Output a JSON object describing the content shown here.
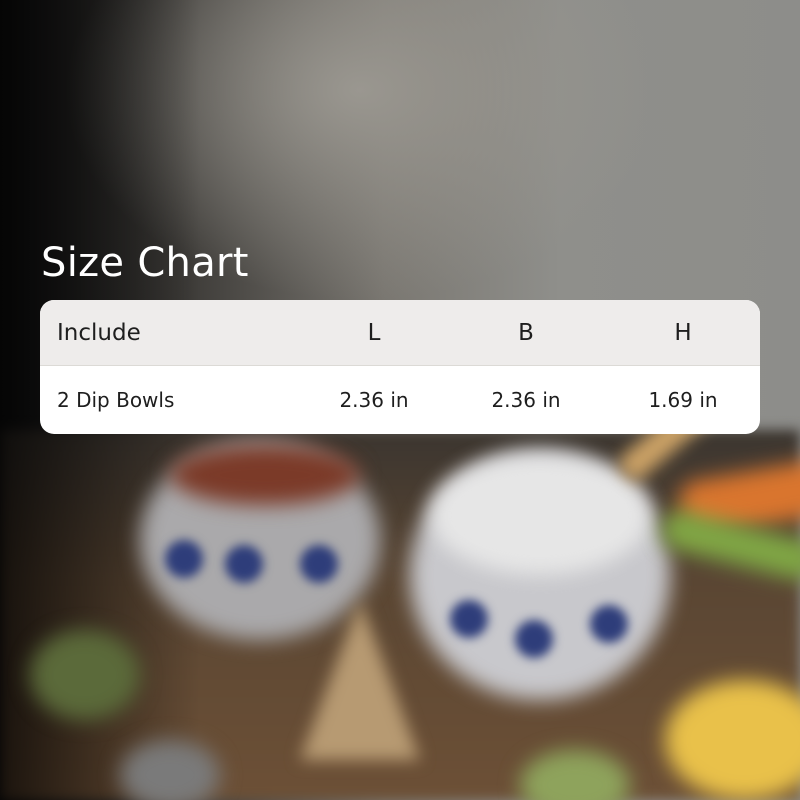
{
  "title": "Size Chart",
  "table": {
    "headers": [
      "Include",
      "L",
      "B",
      "H"
    ],
    "rows": [
      [
        "2 Dip Bowls",
        "2.36 in",
        "2.36 in",
        "1.69 in"
      ]
    ]
  },
  "colors": {
    "title_text": "#ffffff",
    "header_bg": "#eeeceb",
    "card_bg": "#ffffff",
    "text": "#1e1e1e"
  }
}
